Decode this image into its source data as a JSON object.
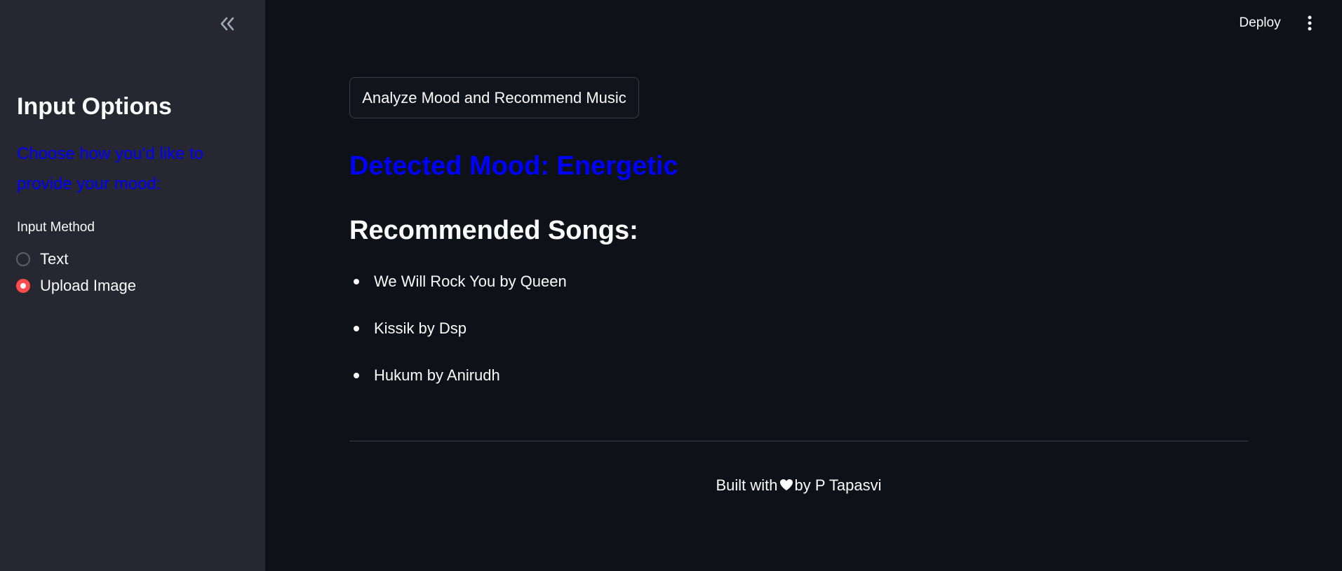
{
  "sidebar": {
    "title": "Input Options",
    "subtitle": "Choose how you'd like to provide your mood:",
    "radio_label": "Input Method",
    "options": [
      {
        "label": "Text",
        "selected": false
      },
      {
        "label": "Upload Image",
        "selected": true
      }
    ],
    "collapse_icon": "double-chevron-left-icon"
  },
  "header": {
    "deploy_label": "Deploy",
    "menu_icon": "vertical-ellipsis-icon"
  },
  "main": {
    "analyze_button": "Analyze Mood and Recommend Music",
    "mood_heading": "Detected Mood: Energetic",
    "songs_heading": "Recommended Songs:",
    "songs": [
      "We Will Rock You by Queen",
      "Kissik by Dsp",
      "Hukum by Anirudh"
    ],
    "footer_before": "Built with",
    "footer_after": "by P Tapasvi"
  },
  "colors": {
    "background": "#0e1117",
    "sidebar": "#262730",
    "accent_blue": "#0000ff",
    "radio_selected": "#ff4b4b"
  }
}
